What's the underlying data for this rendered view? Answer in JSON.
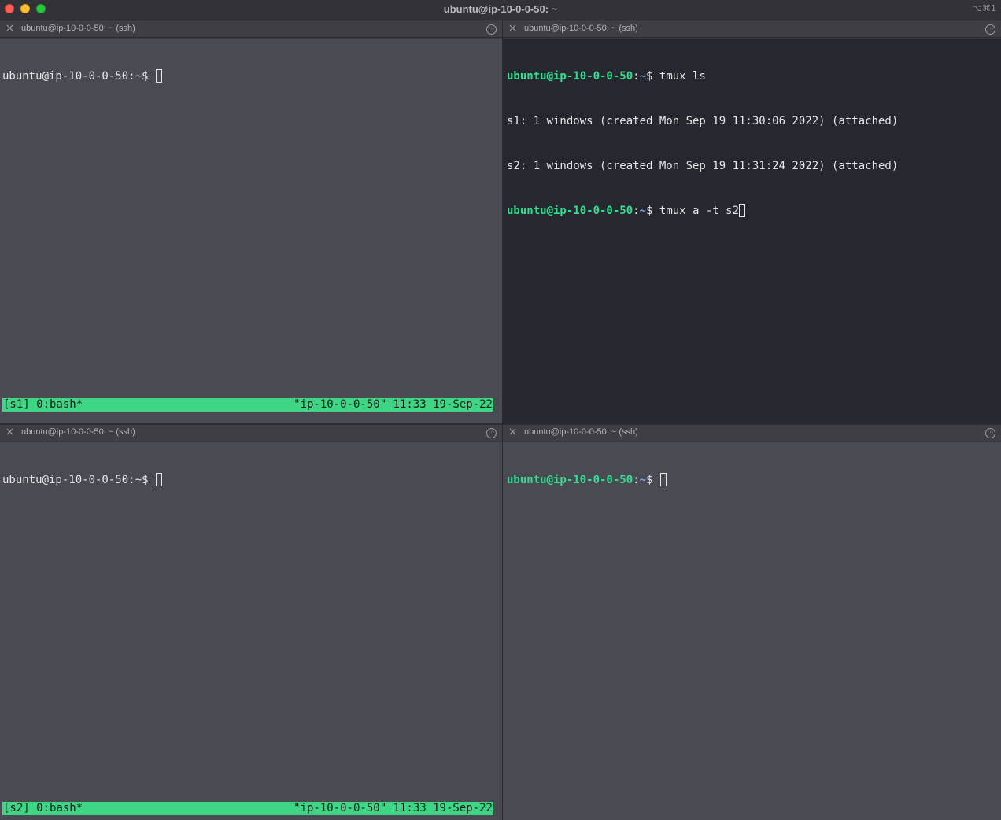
{
  "window": {
    "title": "ubuntu@ip-10-0-0-50: ~",
    "shortcut": "⌥⌘1"
  },
  "colors": {
    "status_bar": "#3ed585",
    "prompt_user": "#2fe08f",
    "prompt_path": "#6aa6ff",
    "active_pane_bg": "#27272f",
    "inactive_pane_bg": "#4a4a52"
  },
  "icons": {
    "tab_close": "close-icon",
    "tab_menu": "ellipsis-circle-icon"
  },
  "panes": {
    "top_left": {
      "tab_title": "ubuntu@ip-10-0-0-50: ~ (ssh)",
      "prompt": "ubuntu@ip-10-0-0-50:~$ ",
      "status_left": "[s1] 0:bash*",
      "status_right": "\"ip-10-0-0-50\" 11:33 19-Sep-22"
    },
    "top_right": {
      "tab_title": "ubuntu@ip-10-0-0-50: ~ (ssh)",
      "prompt_user": "ubuntu@ip-10-0-0-50",
      "prompt_sep": ":",
      "prompt_path": "~",
      "prompt_end": "$ ",
      "command1": "tmux ls",
      "output": [
        "s1: 1 windows (created Mon Sep 19 11:30:06 2022) (attached)",
        "s2: 1 windows (created Mon Sep 19 11:31:24 2022) (attached)"
      ],
      "command2": "tmux a -t s2"
    },
    "bottom_left": {
      "tab_title": "ubuntu@ip-10-0-0-50: ~ (ssh)",
      "prompt": "ubuntu@ip-10-0-0-50:~$ ",
      "status_left": "[s2] 0:bash*",
      "status_right": "\"ip-10-0-0-50\" 11:33 19-Sep-22"
    },
    "bottom_right": {
      "tab_title": "ubuntu@ip-10-0-0-50: ~ (ssh)",
      "prompt_user": "ubuntu@ip-10-0-0-50",
      "prompt_sep": ":",
      "prompt_path": "~",
      "prompt_end": "$ "
    }
  }
}
